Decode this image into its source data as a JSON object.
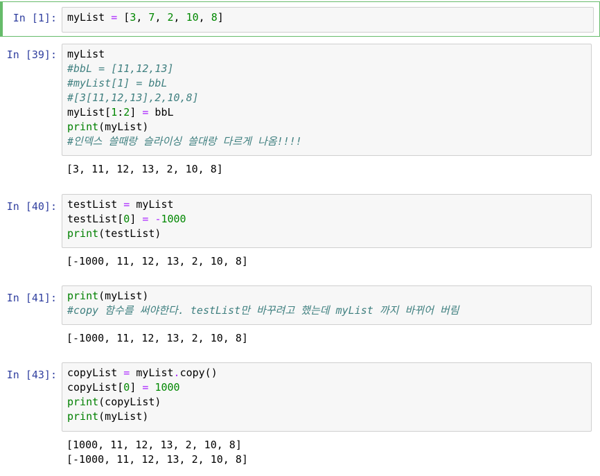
{
  "cells": [
    {
      "prompt": "In [1]:",
      "input": [
        [
          [
            "pl",
            "myList "
          ],
          [
            "op",
            "="
          ],
          [
            "pl",
            " ["
          ],
          [
            "num",
            "3"
          ],
          [
            "pl",
            ", "
          ],
          [
            "num",
            "7"
          ],
          [
            "pl",
            ", "
          ],
          [
            "num",
            "2"
          ],
          [
            "pl",
            ", "
          ],
          [
            "num",
            "10"
          ],
          [
            "pl",
            ", "
          ],
          [
            "num",
            "8"
          ],
          [
            "pl",
            "]"
          ]
        ]
      ],
      "output": []
    },
    {
      "prompt": "In [39]:",
      "input": [
        [
          [
            "pl",
            "myList"
          ]
        ],
        [
          [
            "cm",
            "#bbL = [11,12,13]"
          ]
        ],
        [
          [
            "cm",
            "#myList[1] = bbL"
          ]
        ],
        [
          [
            "cm",
            "#[3[11,12,13],2,10,8]"
          ]
        ],
        [
          [
            "pl",
            "myList["
          ],
          [
            "num",
            "1"
          ],
          [
            "pl",
            ":"
          ],
          [
            "num",
            "2"
          ],
          [
            "pl",
            "] "
          ],
          [
            "op",
            "="
          ],
          [
            "pl",
            " bbL"
          ]
        ],
        [
          [
            "kw",
            "print"
          ],
          [
            "pl",
            "(myList)"
          ]
        ],
        [
          [
            "cm",
            "#인덱스 쓸때랑 슬라이싱 쓸대랑 다르게 나옴!!!!"
          ]
        ]
      ],
      "output": [
        "[3, 11, 12, 13, 2, 10, 8]"
      ]
    },
    {
      "prompt": "In [40]:",
      "input": [
        [
          [
            "pl",
            "testList "
          ],
          [
            "op",
            "="
          ],
          [
            "pl",
            " myList"
          ]
        ],
        [
          [
            "pl",
            "testList["
          ],
          [
            "num",
            "0"
          ],
          [
            "pl",
            "] "
          ],
          [
            "op",
            "="
          ],
          [
            "pl",
            " "
          ],
          [
            "op",
            "-"
          ],
          [
            "num",
            "1000"
          ]
        ],
        [
          [
            "kw",
            "print"
          ],
          [
            "pl",
            "(testList)"
          ]
        ]
      ],
      "output": [
        "[-1000, 11, 12, 13, 2, 10, 8]"
      ]
    },
    {
      "prompt": "In [41]:",
      "input": [
        [
          [
            "kw",
            "print"
          ],
          [
            "pl",
            "(myList)"
          ]
        ],
        [
          [
            "cm",
            "#copy 함수를 써야한다. testList만 바꾸려고 했는데 myList 까지 바뀌어 버림"
          ]
        ]
      ],
      "output": [
        "[-1000, 11, 12, 13, 2, 10, 8]"
      ]
    },
    {
      "prompt": "In [43]:",
      "input": [
        [
          [
            "pl",
            "copyList "
          ],
          [
            "op",
            "="
          ],
          [
            "pl",
            " myList"
          ],
          [
            "op",
            "."
          ],
          [
            "pl",
            "copy()"
          ]
        ],
        [
          [
            "pl",
            "copyList["
          ],
          [
            "num",
            "0"
          ],
          [
            "pl",
            "] "
          ],
          [
            "op",
            "="
          ],
          [
            "pl",
            " "
          ],
          [
            "num",
            "1000"
          ]
        ],
        [
          [
            "kw",
            "print"
          ],
          [
            "pl",
            "(copyList)"
          ]
        ],
        [
          [
            "kw",
            "print"
          ],
          [
            "pl",
            "(myList)"
          ]
        ]
      ],
      "output": [
        "[1000, 11, 12, 13, 2, 10, 8]",
        "[-1000, 11, 12, 13, 2, 10, 8]"
      ]
    }
  ]
}
